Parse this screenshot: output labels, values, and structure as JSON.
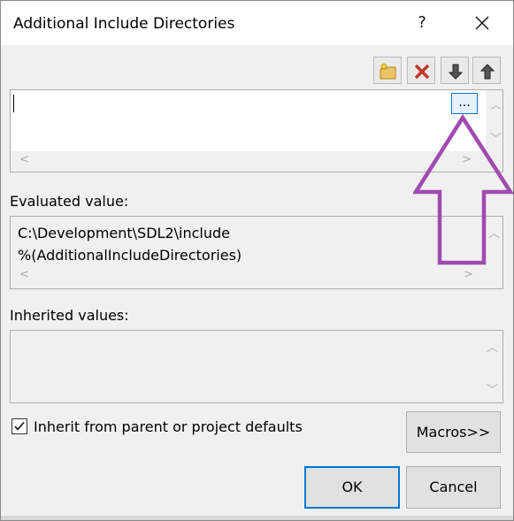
{
  "window": {
    "title": "Additional Include Directories",
    "help_label": "?"
  },
  "toolbar": {
    "buttons": [
      "new-line",
      "delete",
      "move-down",
      "move-up"
    ]
  },
  "editor": {
    "browse_label": "..."
  },
  "evaluated": {
    "label": "Evaluated value:",
    "lines": [
      "C:\\Development\\SDL2\\include",
      "%(AdditionalIncludeDirectories)"
    ]
  },
  "inherited": {
    "label": "Inherited values:"
  },
  "inherit_checkbox": {
    "label": "Inherit from parent or project defaults",
    "checked": true
  },
  "buttons": {
    "macros": "Macros>>",
    "ok": "OK",
    "cancel": "Cancel"
  },
  "annotation": {
    "arrow_color": "#a04bb0"
  }
}
